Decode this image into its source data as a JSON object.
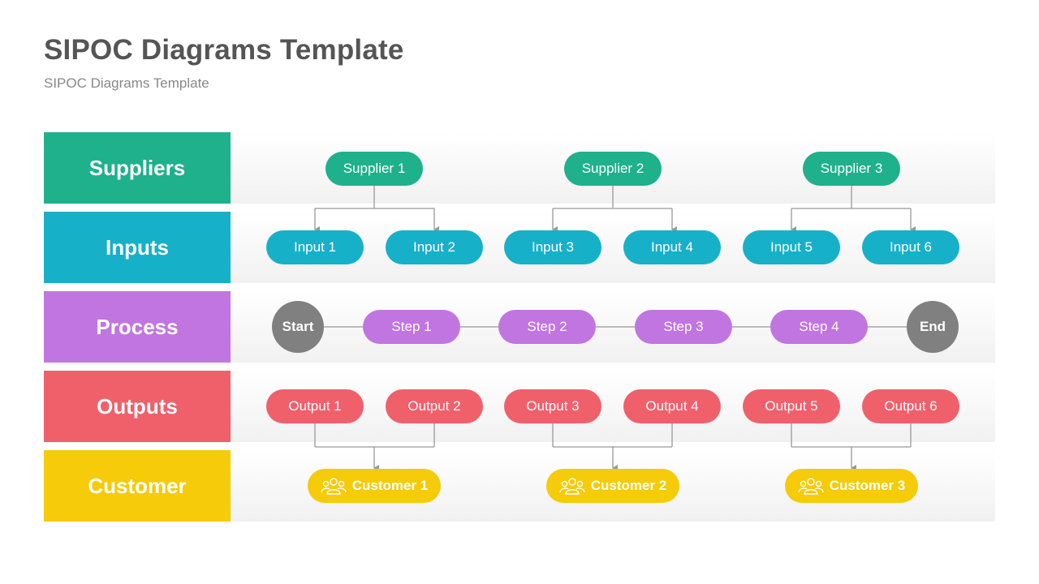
{
  "header": {
    "title": "SIPOC Diagrams Template",
    "subtitle": "SIPOC Diagrams Template"
  },
  "colors": {
    "suppliers": "#1fb08c",
    "inputs": "#17b0c9",
    "process": "#c175e1",
    "outputs": "#ef606b",
    "customer": "#f5cb0a",
    "start_end": "#808080",
    "connector": "#999999"
  },
  "rows": [
    {
      "key": "suppliers",
      "label": "Suppliers"
    },
    {
      "key": "inputs",
      "label": "Inputs"
    },
    {
      "key": "process",
      "label": "Process"
    },
    {
      "key": "outputs",
      "label": "Outputs"
    },
    {
      "key": "customer",
      "label": "Customer"
    }
  ],
  "suppliers": [
    "Supplier 1",
    "Supplier 2",
    "Supplier 3"
  ],
  "inputs": [
    "Input 1",
    "Input 2",
    "Input 3",
    "Input 4",
    "Input 5",
    "Input 6"
  ],
  "process": {
    "start": "Start",
    "steps": [
      "Step 1",
      "Step 2",
      "Step 3",
      "Step 4"
    ],
    "end": "End"
  },
  "outputs": [
    "Output 1",
    "Output 2",
    "Output 3",
    "Output 4",
    "Output 5",
    "Output 6"
  ],
  "customers": [
    {
      "label": "Customer 1",
      "icon": "users-group-icon"
    },
    {
      "label": "Customer 2",
      "icon": "users-group-icon"
    },
    {
      "label": "Customer 3",
      "icon": "users-group-icon"
    }
  ]
}
